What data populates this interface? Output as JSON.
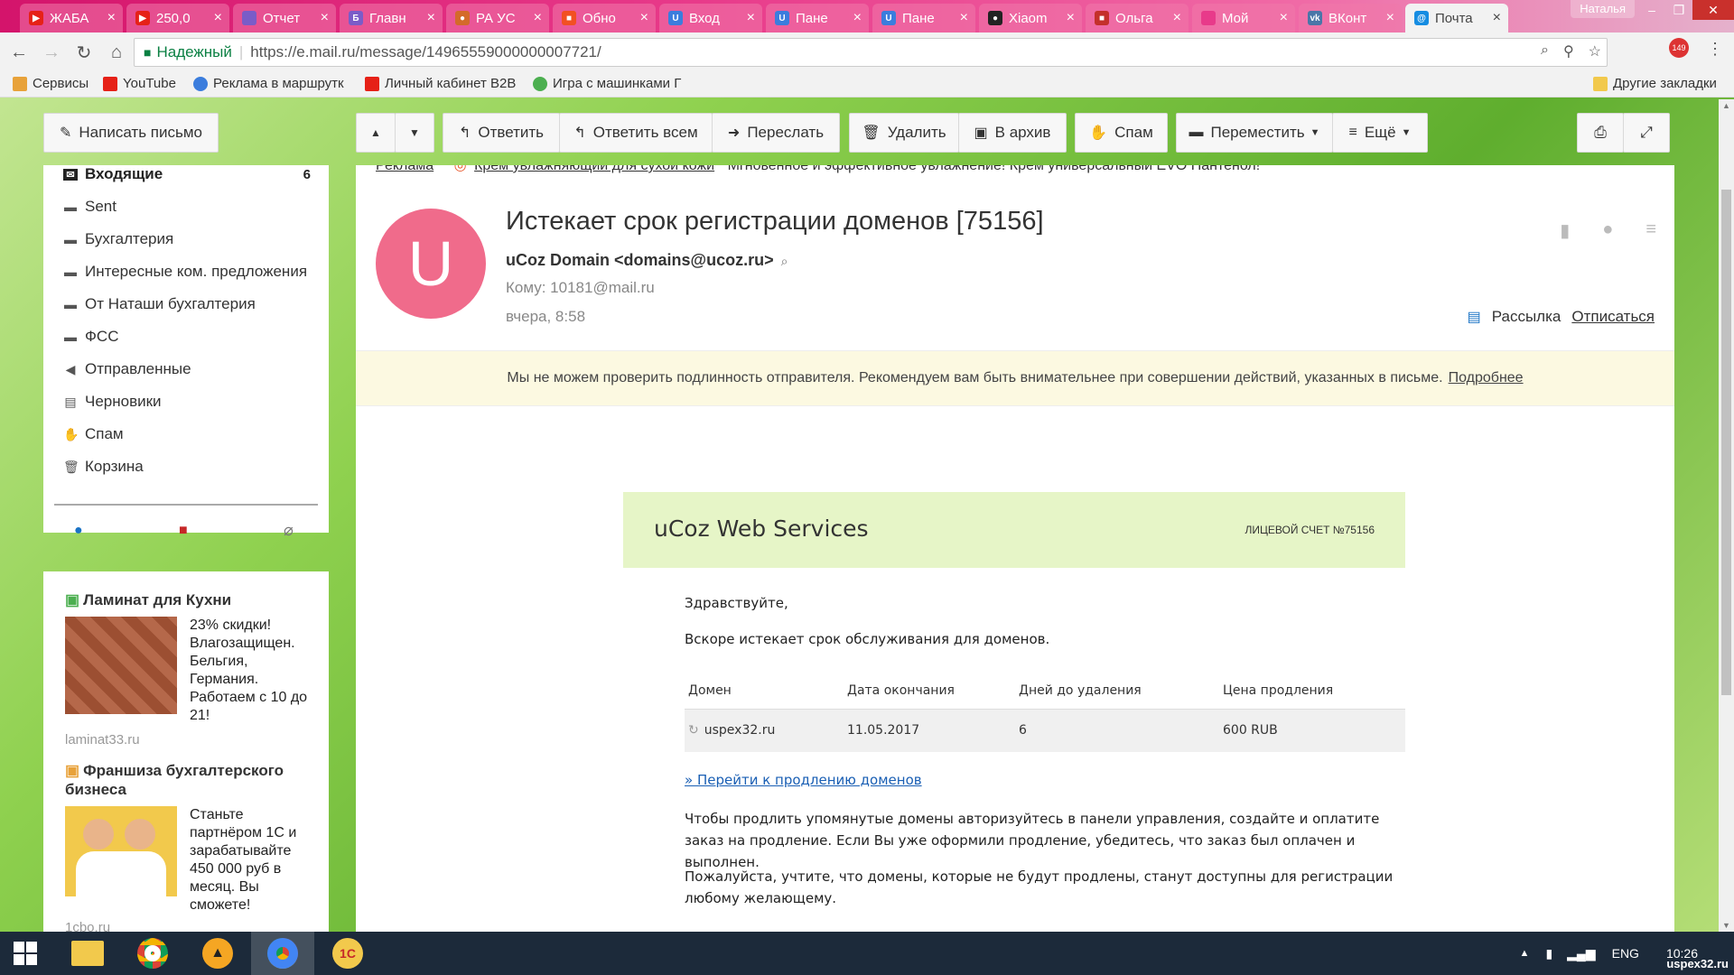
{
  "browser": {
    "tabs": [
      {
        "label": "ЖАБА",
        "fav_color": "#e62117",
        "fav_glyph": "▶"
      },
      {
        "label": "250,0",
        "fav_color": "#e62117",
        "fav_glyph": "▶"
      },
      {
        "label": "Отчет",
        "fav_color": "#7a5cc8",
        "fav_glyph": ""
      },
      {
        "label": "Главн",
        "fav_color": "#7a5cc8",
        "fav_glyph": "Б"
      },
      {
        "label": "РА УС",
        "fav_color": "#d46a2a",
        "fav_glyph": "●"
      },
      {
        "label": "Обно",
        "fav_color": "#f25022",
        "fav_glyph": "■"
      },
      {
        "label": "Вход",
        "fav_color": "#3b7ddd",
        "fav_glyph": "U"
      },
      {
        "label": "Пане",
        "fav_color": "#3b7ddd",
        "fav_glyph": "U"
      },
      {
        "label": "Пане",
        "fav_color": "#3b7ddd",
        "fav_glyph": "U"
      },
      {
        "label": "Xiaom",
        "fav_color": "#222222",
        "fav_glyph": "●"
      },
      {
        "label": "Ольга",
        "fav_color": "#c4302b",
        "fav_glyph": "■"
      },
      {
        "label": "Мой",
        "fav_color": "#e83a8a",
        "fav_glyph": ""
      },
      {
        "label": "ВКонт",
        "fav_color": "#4a76a8",
        "fav_glyph": "vk"
      },
      {
        "label": "Почта",
        "fav_color": "#168de2",
        "fav_glyph": "@"
      }
    ],
    "tab_close": "×",
    "profile_name": "Наталья",
    "window_buttons": {
      "minimize": "–",
      "maximize": "❐",
      "close": "✕"
    },
    "nav": {
      "back": "←",
      "forward": "→",
      "reload": "↻",
      "home": "⌂"
    },
    "address": {
      "secure_label": "Надежный",
      "url": "https://e.mail.ru/message/14965559000000007721/"
    },
    "ext_badge": "149",
    "bookmarks": [
      {
        "label": "Сервисы",
        "color": "#e8a23a"
      },
      {
        "label": "YouTube",
        "color": "#e62117"
      },
      {
        "label": "Реклама в маршрутк",
        "color": "#3b7ddd"
      },
      {
        "label": "Личный кабинет В2В",
        "color": "#e62117"
      },
      {
        "label": "Игра с машинками Г",
        "color": "#4caf50"
      }
    ],
    "other_bookmarks": "Другие закладки"
  },
  "mail": {
    "compose_label": "Написать письмо",
    "toolbar": {
      "up": "▲",
      "down": "▼",
      "reply": "Ответить",
      "reply_all": "Ответить всем",
      "forward": "Переслать",
      "delete": "Удалить",
      "archive": "В архив",
      "spam": "Спам",
      "move": "Переместить",
      "more": "Ещё"
    },
    "folders": [
      {
        "label": "Входящие",
        "count": "6",
        "icon": "✉"
      },
      {
        "label": "Sent",
        "icon": "▬"
      },
      {
        "label": "Бухгалтерия",
        "icon": "▬"
      },
      {
        "label": "Интересные ком. предложения",
        "icon": "▬"
      },
      {
        "label": "От Наташи бухгалтерия",
        "icon": "▬"
      },
      {
        "label": "ФСС",
        "icon": "▬"
      },
      {
        "label": "Отправленные",
        "icon": "◀"
      },
      {
        "label": "Черновики",
        "icon": "▤"
      },
      {
        "label": "Спам",
        "icon": "✋"
      },
      {
        "label": "Корзина",
        "icon": "🗑"
      }
    ],
    "filters": {
      "unread": "●",
      "flagged": "🔖",
      "attachments": "📎"
    },
    "ads": [
      {
        "title": "Ламинат для Кухни",
        "text": "23% скидки! Влагозащищен. Бельгия, Германия. Работаем с 10 до 21!",
        "site": "laminat33.ru"
      },
      {
        "title": "Франшиза бухгалтерского бизнеса",
        "text": "Станьте партнёром 1С и зарабатывайте 450 000 руб в месяц. Вы сможете!",
        "site": "1cbo.ru"
      }
    ],
    "message": {
      "top_ad": {
        "label": "Реклама",
        "link": "Крем увлажняющий для сухой кожи",
        "text": "Мгновенное и эффективное увлажнение! Крем универсальный EVO Пантенол!"
      },
      "avatar_letter": "U",
      "subject": "Истекает срок регистрации доменов [75156]",
      "from": "uCoz Domain <domains@ucoz.ru>",
      "to": "Кому: 10181@mail.ru",
      "date": "вчера, 8:58",
      "newsletter_label": "Рассылка",
      "unsubscribe": "Отписаться",
      "warning": "Мы не можем проверить подлинность отправителя. Рекомендуем вам быть внимательнее при совершении действий, указанных в письме.",
      "warning_more": "Подробнее",
      "body": {
        "brand": "uCoz Web Services",
        "account": "ЛИЦЕВОЙ СЧЕТ №75156",
        "greeting": "Здравствуйте,",
        "intro": "Вскоре истекает срок обслуживания для доменов.",
        "table_headers": [
          "Домен",
          "Дата окончания",
          "Дней до удаления",
          "Цена продления"
        ],
        "table_rows": [
          [
            "uspex32.ru",
            "11.05.2017",
            "6",
            "600 RUB"
          ]
        ],
        "renew_link": "» Перейти к продлению доменов",
        "para1": "Чтобы продлить упомянутые домены авторизуйтесь в панели управления, создайте и оплатите заказ на продление. Если Вы уже оформили продление, убедитесь, что заказ был оплачен и выполнен.",
        "para2": "Пожалуйста, учтите, что домены, которые не будут продлены, станут доступны для регистрации любому желающему."
      }
    }
  },
  "taskbar": {
    "lang": "ENG",
    "time": "10:26",
    "watermark": "uspex32.ru"
  }
}
